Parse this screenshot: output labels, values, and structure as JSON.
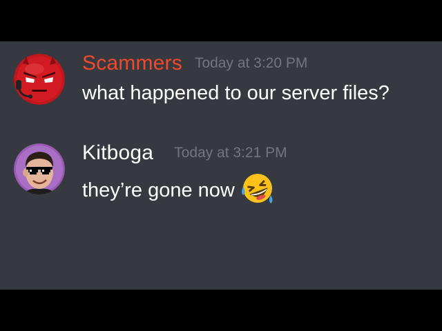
{
  "messages": [
    {
      "username": "Scammers",
      "username_color": "#f04a2c",
      "timestamp": "Today at 3:20 PM",
      "text": "what happened to our server files?",
      "avatar_icon": "red-angry-face-headset-icon"
    },
    {
      "username": "Kitboga",
      "username_color": "#ffffff",
      "timestamp": "Today at 3:21 PM",
      "text": "they’re gone now",
      "avatar_icon": "man-pixel-sunglasses-icon",
      "emoji": "rolling-on-floor-laughing-icon"
    }
  ],
  "colors": {
    "background": "#36393f",
    "timestamp": "#72767d",
    "text": "#ffffff",
    "letterbox": "#000000"
  }
}
